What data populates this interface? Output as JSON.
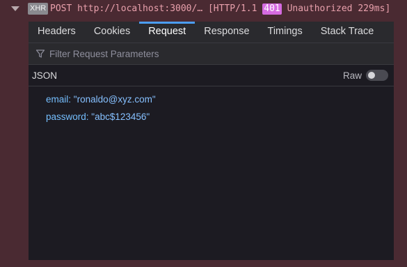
{
  "request": {
    "type_badge": "XHR",
    "method": "POST",
    "url": "http://localhost:3000/…",
    "protocol": "[HTTP/1.1",
    "status_code": "401",
    "status_text": "Unauthorized",
    "time": "229ms]"
  },
  "tabs": [
    {
      "label": "Headers",
      "active": false
    },
    {
      "label": "Cookies",
      "active": false
    },
    {
      "label": "Request",
      "active": true
    },
    {
      "label": "Response",
      "active": false
    },
    {
      "label": "Timings",
      "active": false
    },
    {
      "label": "Stack Trace",
      "active": false
    }
  ],
  "filter": {
    "placeholder": "Filter Request Parameters",
    "icon": "funnel-icon"
  },
  "json_section": {
    "label": "JSON",
    "raw_label": "Raw",
    "raw_enabled": false
  },
  "params": [
    {
      "key": "email",
      "value": "\"ronaldo@xyz.com\""
    },
    {
      "key": "password",
      "value": "\"abc$123456\""
    }
  ],
  "colors": {
    "page_bg": "#4a2a32",
    "panel_bg": "#1c1b22",
    "status_badge": "#d66be0",
    "active_tab_accent": "#4c9ef5",
    "request_text": "#e8a0ac",
    "param_text": "#75bfff"
  }
}
